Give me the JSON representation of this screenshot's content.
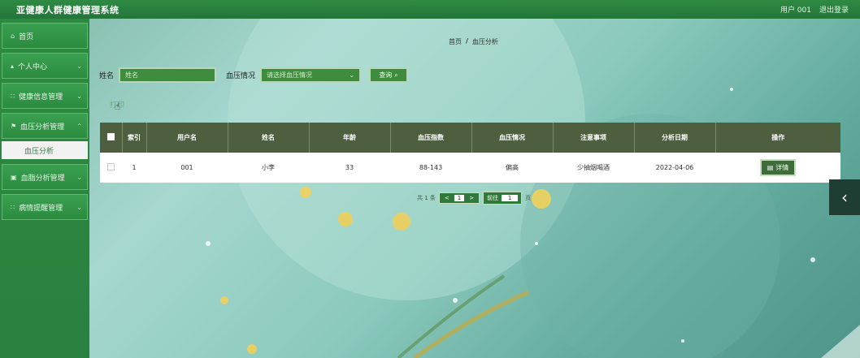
{
  "app": {
    "title": "亚健康人群健康管理系统"
  },
  "topbar": {
    "user_label": "用户 001",
    "logout_label": "退出登录"
  },
  "sidebar": {
    "items": [
      {
        "label": "首页",
        "icon": "home-icon",
        "glyph": "⌂",
        "has_children": false
      },
      {
        "label": "个人中心",
        "icon": "user-icon",
        "glyph": "▴",
        "has_children": true
      },
      {
        "label": "健康信息管理",
        "icon": "grid-icon",
        "glyph": "∷",
        "has_children": true
      },
      {
        "label": "血压分析管理",
        "icon": "flag-icon",
        "glyph": "⚑",
        "has_children": true
      }
    ],
    "active_sub": "血压分析",
    "items_after": [
      {
        "label": "血脂分析管理",
        "icon": "doc-icon",
        "glyph": "▣",
        "has_children": true
      },
      {
        "label": "病情提醒管理",
        "icon": "grid-icon",
        "glyph": "∷",
        "has_children": true
      }
    ]
  },
  "breadcrumb": {
    "home": "首页",
    "separator": "/",
    "current": "血压分析"
  },
  "search": {
    "name_label": "姓名",
    "name_placeholder": "姓名",
    "bp_label": "血压情况",
    "bp_placeholder": "请选择血压情况",
    "query_label": "查询"
  },
  "print_label": "打印",
  "table": {
    "headers": [
      "索引",
      "用户名",
      "姓名",
      "年龄",
      "血压指数",
      "血压情况",
      "注意事项",
      "分析日期",
      "操作"
    ],
    "rows": [
      {
        "index": "1",
        "username": "001",
        "name": "小李",
        "age": "33",
        "bp_index": "88-143",
        "bp_status": "偏高",
        "notes": "少抽烟喝酒",
        "date": "2022-04-06",
        "action": "详情"
      }
    ]
  },
  "pagination": {
    "total_prefix": "共 1 条",
    "prev": "<",
    "page": "1",
    "next": ">",
    "goto_label": "前往",
    "goto_value": "1",
    "page_suffix": "页"
  },
  "colors": {
    "topbar": "#2f8a43",
    "sidebar": "#2c8a3f",
    "table_header": "#4d5f3f",
    "accent": "#3e8c3e"
  }
}
